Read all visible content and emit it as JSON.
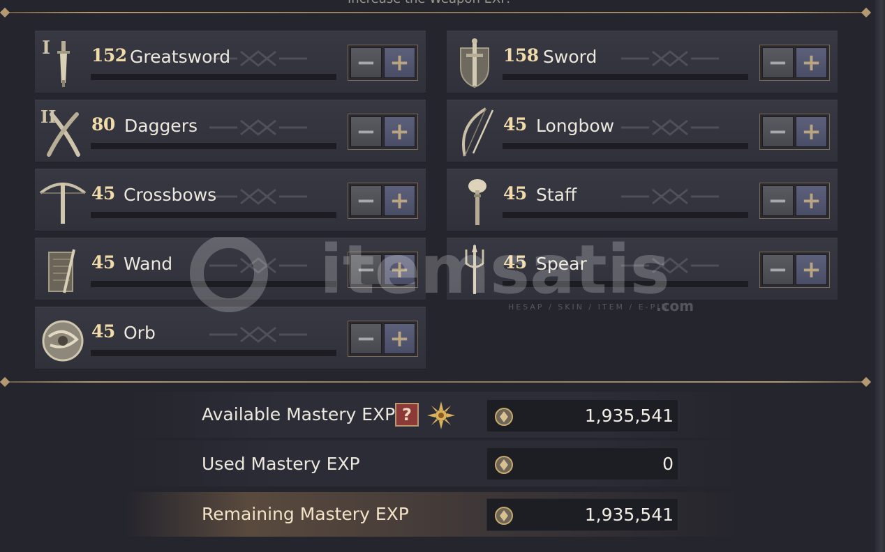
{
  "header": {
    "cut_text": "Increase the Weapon EXP."
  },
  "weapons": [
    {
      "id": "greatsword",
      "level": "152",
      "name": "Greatsword",
      "tier": "I",
      "icon": "greatsword-icon"
    },
    {
      "id": "sword",
      "level": "158",
      "name": "Sword",
      "icon": "sword-shield-icon"
    },
    {
      "id": "daggers",
      "level": "80",
      "name": "Daggers",
      "tier": "II",
      "icon": "daggers-icon"
    },
    {
      "id": "longbow",
      "level": "45",
      "name": "Longbow",
      "icon": "longbow-icon"
    },
    {
      "id": "crossbows",
      "level": "45",
      "name": "Crossbows",
      "icon": "crossbow-icon"
    },
    {
      "id": "staff",
      "level": "45",
      "name": "Staff",
      "icon": "staff-icon"
    },
    {
      "id": "wand",
      "level": "45",
      "name": "Wand",
      "icon": "wand-tome-icon"
    },
    {
      "id": "spear",
      "level": "45",
      "name": "Spear",
      "icon": "trident-spear-icon"
    },
    {
      "id": "orb",
      "level": "45",
      "name": "Orb",
      "icon": "orb-icon"
    }
  ],
  "controls": {
    "minus": "−",
    "plus": "+"
  },
  "summary": {
    "available_label": "Available Mastery EXP",
    "available_value": "1,935,541",
    "help": "?",
    "used_label": "Used Mastery EXP",
    "used_value": "0",
    "remaining_label": "Remaining Mastery EXP",
    "remaining_value": "1,935,541"
  },
  "watermark": {
    "brand": "itemsatis",
    "tagline": "HESAP / SKIN / ITEM / E-PIN",
    "suffix": ".com"
  },
  "colors": {
    "level": "#f1dca9",
    "gold_border": "#b49a73",
    "panel": "#25252d"
  }
}
